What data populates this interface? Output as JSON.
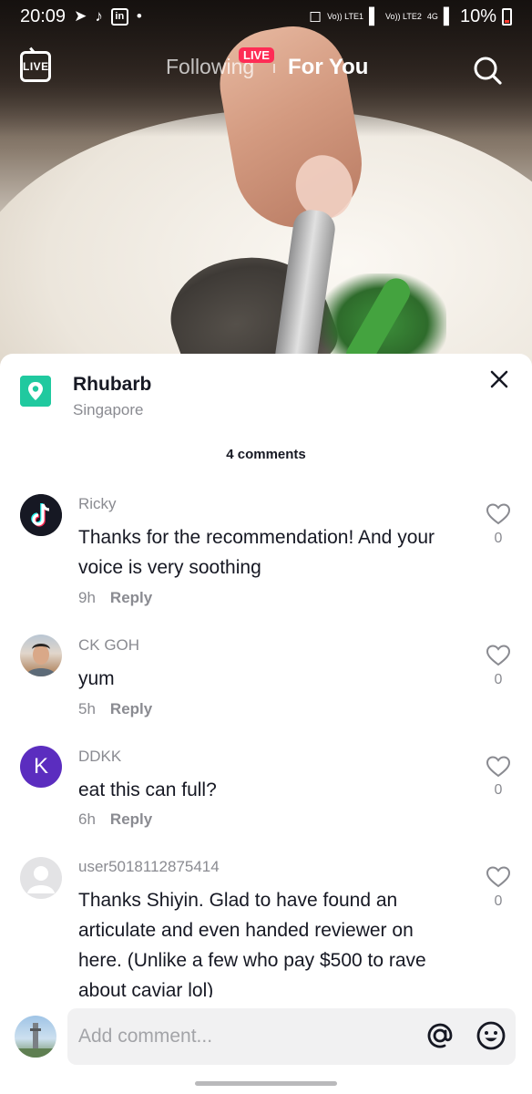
{
  "status_bar": {
    "time": "20:09",
    "network_left": "Vo)) LTE1",
    "network_right": "Vo)) LTE2",
    "network_type": "4G",
    "battery": "10%"
  },
  "top_nav": {
    "live_label": "LIVE",
    "following_label": "Following",
    "live_badge": "LIVE",
    "for_you_label": "For You"
  },
  "location": {
    "name": "Rhubarb",
    "city": "Singapore"
  },
  "comments_count": "4 comments",
  "comments": [
    {
      "user": "Ricky",
      "text": "Thanks for the recommendation! And your voice is very soothing",
      "age": "9h",
      "reply": "Reply",
      "likes": "0",
      "avatar_letter": ""
    },
    {
      "user": "CK GOH",
      "text": "yum",
      "age": "5h",
      "reply": "Reply",
      "likes": "0",
      "avatar_letter": ""
    },
    {
      "user": "DDKK",
      "text": "eat this can full?",
      "age": "6h",
      "reply": "Reply",
      "likes": "0",
      "avatar_letter": "K"
    },
    {
      "user": "user5018112875414",
      "text": "Thanks Shiyin. Glad to have found an articulate and even handed reviewer on here. (Unlike a few who pay $500 to rave about caviar lol)",
      "age": "",
      "reply": "",
      "likes": "0",
      "avatar_letter": ""
    }
  ],
  "composer": {
    "placeholder": "Add comment..."
  },
  "colors": {
    "accent": "#fe2c55",
    "location": "#20c99f",
    "ddkk_avatar": "#5b2dbf"
  }
}
